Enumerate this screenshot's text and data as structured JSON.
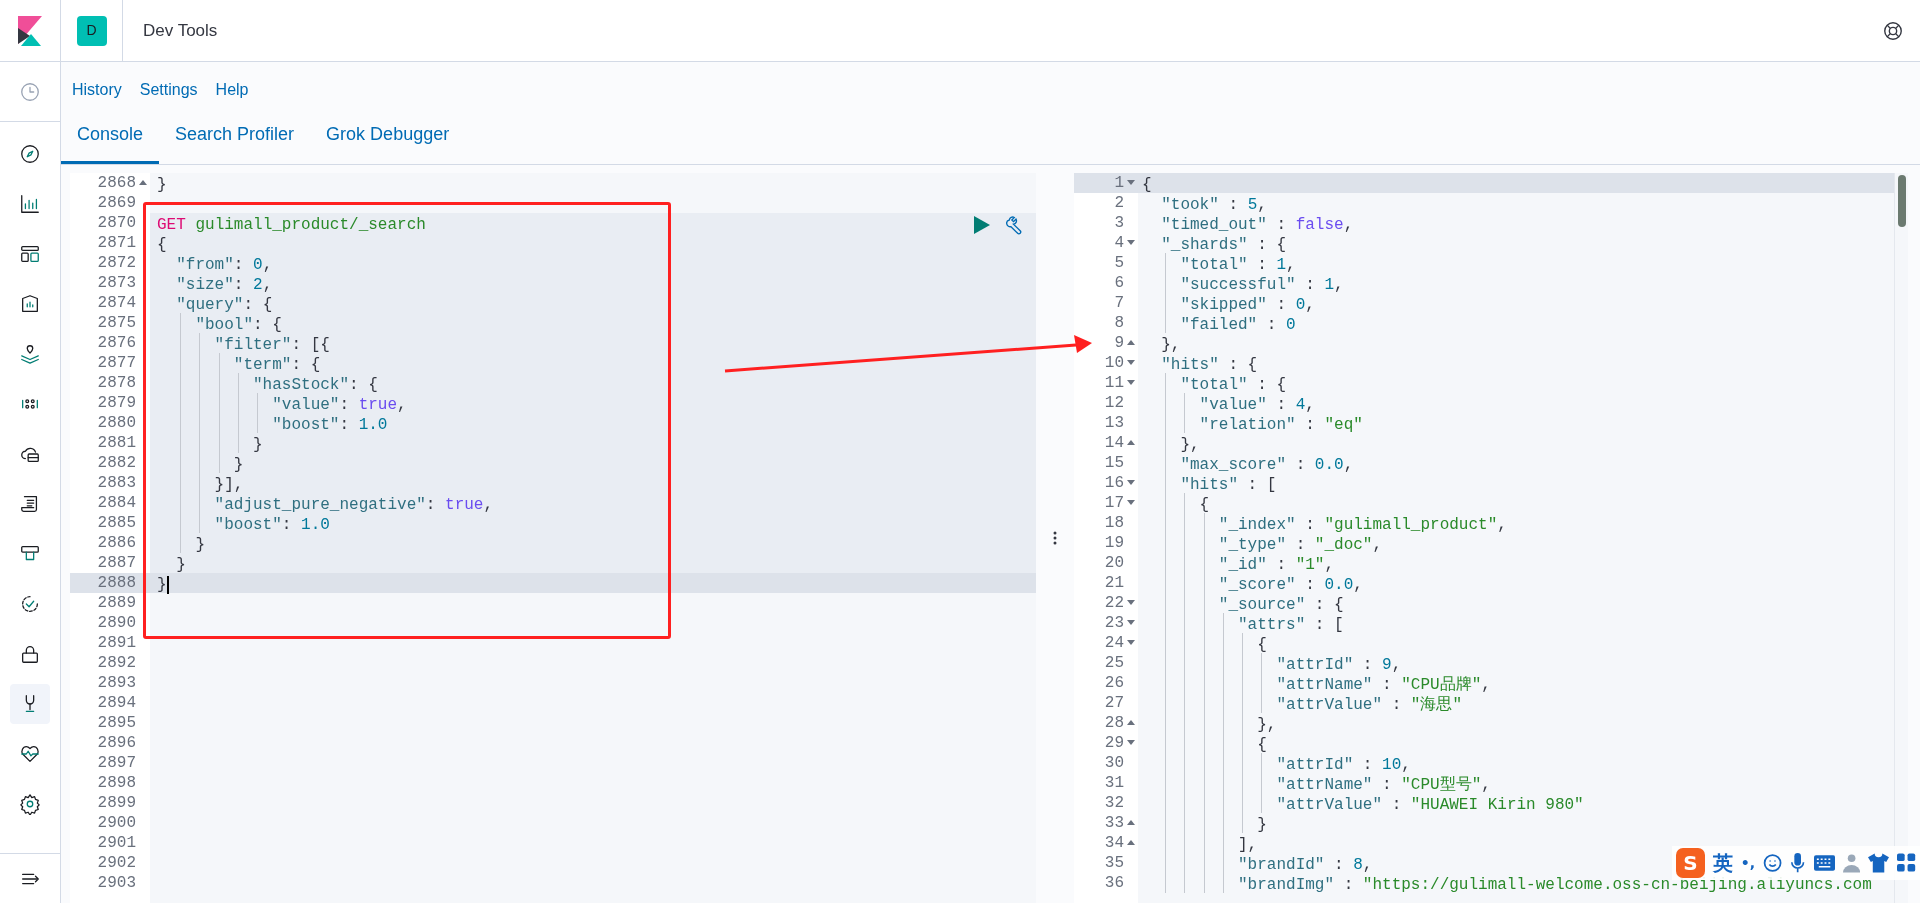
{
  "header": {
    "space_avatar": "D",
    "title": "Dev Tools"
  },
  "nav_items": [
    {
      "kind": "recent",
      "selected": false
    },
    {
      "kind": "discover",
      "selected": false
    },
    {
      "kind": "visualize",
      "selected": false
    },
    {
      "kind": "dashboard",
      "selected": false
    },
    {
      "kind": "canvas",
      "selected": false
    },
    {
      "kind": "maps",
      "selected": false
    },
    {
      "kind": "ml",
      "selected": false
    },
    {
      "kind": "infra",
      "selected": false
    },
    {
      "kind": "logs",
      "selected": false
    },
    {
      "kind": "apm",
      "selected": false
    },
    {
      "kind": "uptime",
      "selected": false
    },
    {
      "kind": "siem",
      "selected": false
    },
    {
      "kind": "devtools",
      "selected": true
    },
    {
      "kind": "monitoring",
      "selected": false
    },
    {
      "kind": "management",
      "selected": false
    },
    {
      "kind": "collapse",
      "selected": false
    }
  ],
  "top_links": [
    "History",
    "Settings",
    "Help"
  ],
  "tabs": [
    {
      "label": "Console",
      "selected": true
    },
    {
      "label": "Search Profiler",
      "selected": false
    },
    {
      "label": "Grok Debugger",
      "selected": false
    }
  ],
  "request_editor": {
    "lines": [
      {
        "number": "2868",
        "kind": "fold_end",
        "text": "}",
        "in_request": false,
        "current": false
      },
      {
        "number": "2869",
        "kind": "code",
        "in_request": false,
        "current": false
      },
      {
        "number": "2870",
        "kind": "request",
        "method": "GET",
        "path": "gulimall_product/_search",
        "in_request": true,
        "current": false
      },
      {
        "number": "2871",
        "kind": "code",
        "text": "{",
        "in_request": true,
        "current": false
      },
      {
        "number": "2872",
        "kind": "code",
        "text": "  \"from\": 0,",
        "in_request": true,
        "current": false
      },
      {
        "number": "2873",
        "kind": "code",
        "text": "  \"size\": 2,",
        "in_request": true,
        "current": false
      },
      {
        "number": "2874",
        "kind": "code",
        "text": "  \"query\": {",
        "in_request": true,
        "current": false
      },
      {
        "number": "2875",
        "kind": "code",
        "text": "    \"bool\": {",
        "in_request": true,
        "current": false
      },
      {
        "number": "2876",
        "kind": "code",
        "text": "      \"filter\": [{",
        "in_request": true,
        "current": false
      },
      {
        "number": "2877",
        "kind": "code",
        "text": "        \"term\": {",
        "in_request": true,
        "current": false
      },
      {
        "number": "2878",
        "kind": "code",
        "text": "          \"hasStock\": {",
        "in_request": true,
        "current": false
      },
      {
        "number": "2879",
        "kind": "code",
        "text": "            \"value\": true,",
        "in_request": true,
        "current": false
      },
      {
        "number": "2880",
        "kind": "code",
        "text": "            \"boost\": 1.0",
        "in_request": true,
        "current": false
      },
      {
        "number": "2881",
        "kind": "code",
        "text": "          }",
        "in_request": true,
        "current": false
      },
      {
        "number": "2882",
        "kind": "code",
        "text": "        }",
        "in_request": true,
        "current": false
      },
      {
        "number": "2883",
        "kind": "code",
        "text": "      }],",
        "in_request": true,
        "current": false
      },
      {
        "number": "2884",
        "kind": "code",
        "text": "      \"adjust_pure_negative\": true,",
        "in_request": true,
        "current": false
      },
      {
        "number": "2885",
        "kind": "code",
        "text": "      \"boost\": 1.0",
        "in_request": true,
        "current": false
      },
      {
        "number": "2886",
        "kind": "code",
        "text": "    }",
        "in_request": true,
        "current": false
      },
      {
        "number": "2887",
        "kind": "code",
        "text": "  }",
        "in_request": true,
        "current": false
      },
      {
        "number": "2888",
        "kind": "code",
        "text": "}",
        "in_request": true,
        "current": true
      },
      {
        "number": "2889",
        "kind": "code",
        "in_request": false,
        "current": false
      },
      {
        "number": "2890",
        "kind": "code",
        "in_request": false,
        "current": false
      },
      {
        "number": "2891",
        "kind": "code",
        "in_request": false,
        "current": false
      },
      {
        "number": "2892",
        "kind": "code",
        "in_request": false,
        "current": false
      },
      {
        "number": "2893",
        "kind": "code",
        "in_request": false,
        "current": false
      },
      {
        "number": "2894",
        "kind": "code",
        "in_request": false,
        "current": false
      },
      {
        "number": "2895",
        "kind": "code",
        "in_request": false,
        "current": false
      },
      {
        "number": "2896",
        "kind": "code",
        "in_request": false,
        "current": false
      },
      {
        "number": "2897",
        "kind": "code",
        "in_request": false,
        "current": false
      },
      {
        "number": "2898",
        "kind": "code",
        "in_request": false,
        "current": false
      },
      {
        "number": "2899",
        "kind": "code",
        "in_request": false,
        "current": false
      },
      {
        "number": "2900",
        "kind": "code",
        "in_request": false,
        "current": false
      },
      {
        "number": "2901",
        "kind": "code",
        "in_request": false,
        "current": false
      },
      {
        "number": "2902",
        "kind": "code",
        "in_request": false,
        "current": false
      },
      {
        "number": "2903",
        "kind": "code",
        "in_request": false,
        "current": false
      }
    ]
  },
  "response_editor": {
    "lines": [
      {
        "number": "1",
        "kind": "fold_start",
        "text": "{",
        "current": true
      },
      {
        "number": "2",
        "kind": "code",
        "text": "  \"took\" : 5,",
        "current": false
      },
      {
        "number": "3",
        "kind": "code",
        "text": "  \"timed_out\" : false,",
        "current": false
      },
      {
        "number": "4",
        "kind": "fold_start",
        "text": "  \"_shards\" : {",
        "current": false
      },
      {
        "number": "5",
        "kind": "code",
        "text": "    \"total\" : 1,",
        "current": false
      },
      {
        "number": "6",
        "kind": "code",
        "text": "    \"successful\" : 1,",
        "current": false
      },
      {
        "number": "7",
        "kind": "code",
        "text": "    \"skipped\" : 0,",
        "current": false
      },
      {
        "number": "8",
        "kind": "code",
        "text": "    \"failed\" : 0",
        "current": false
      },
      {
        "number": "9",
        "kind": "fold_end",
        "text": "  },",
        "current": false
      },
      {
        "number": "10",
        "kind": "fold_start",
        "text": "  \"hits\" : {",
        "current": false
      },
      {
        "number": "11",
        "kind": "fold_start",
        "text": "    \"total\" : {",
        "current": false
      },
      {
        "number": "12",
        "kind": "code",
        "text": "      \"value\" : 4,",
        "current": false
      },
      {
        "number": "13",
        "kind": "code",
        "text": "      \"relation\" : \"eq\"",
        "current": false
      },
      {
        "number": "14",
        "kind": "fold_end",
        "text": "    },",
        "current": false
      },
      {
        "number": "15",
        "kind": "code",
        "text": "    \"max_score\" : 0.0,",
        "current": false
      },
      {
        "number": "16",
        "kind": "fold_start",
        "text": "    \"hits\" : [",
        "current": false
      },
      {
        "number": "17",
        "kind": "fold_start",
        "text": "      {",
        "current": false
      },
      {
        "number": "18",
        "kind": "code",
        "text": "        \"_index\" : \"gulimall_product\",",
        "current": false
      },
      {
        "number": "19",
        "kind": "code",
        "text": "        \"_type\" : \"_doc\",",
        "current": false
      },
      {
        "number": "20",
        "kind": "code",
        "text": "        \"_id\" : \"1\",",
        "current": false
      },
      {
        "number": "21",
        "kind": "code",
        "text": "        \"_score\" : 0.0,",
        "current": false
      },
      {
        "number": "22",
        "kind": "fold_start",
        "text": "        \"_source\" : {",
        "current": false
      },
      {
        "number": "23",
        "kind": "fold_start",
        "text": "          \"attrs\" : [",
        "current": false
      },
      {
        "number": "24",
        "kind": "fold_start",
        "text": "            {",
        "current": false
      },
      {
        "number": "25",
        "kind": "code",
        "text": "              \"attrId\" : 9,",
        "current": false
      },
      {
        "number": "26",
        "kind": "code",
        "text": "              \"attrName\" : \"CPU品牌\",",
        "current": false
      },
      {
        "number": "27",
        "kind": "code",
        "text": "              \"attrValue\" : \"海思\"",
        "current": false
      },
      {
        "number": "28",
        "kind": "fold_end",
        "text": "            },",
        "current": false
      },
      {
        "number": "29",
        "kind": "fold_start",
        "text": "            {",
        "current": false
      },
      {
        "number": "30",
        "kind": "code",
        "text": "              \"attrId\" : 10,",
        "current": false
      },
      {
        "number": "31",
        "kind": "code",
        "text": "              \"attrName\" : \"CPU型号\",",
        "current": false
      },
      {
        "number": "32",
        "kind": "code",
        "text": "              \"attrValue\" : \"HUAWEI Kirin 980\"",
        "current": false
      },
      {
        "number": "33",
        "kind": "fold_end",
        "text": "            }",
        "current": false
      },
      {
        "number": "34",
        "kind": "fold_end",
        "text": "          ],",
        "current": false
      },
      {
        "number": "35",
        "kind": "code",
        "text": "          \"brandId\" : 8,",
        "current": false
      },
      {
        "number": "36",
        "kind": "code",
        "text": "          \"brandImg\" : \"https://gulimall-welcome.oss-cn-beijing.aliyuncs.com",
        "current": false
      }
    ]
  },
  "ime_toolbar": {
    "logo": "S",
    "mode": "英",
    "punctuation": "•,"
  }
}
